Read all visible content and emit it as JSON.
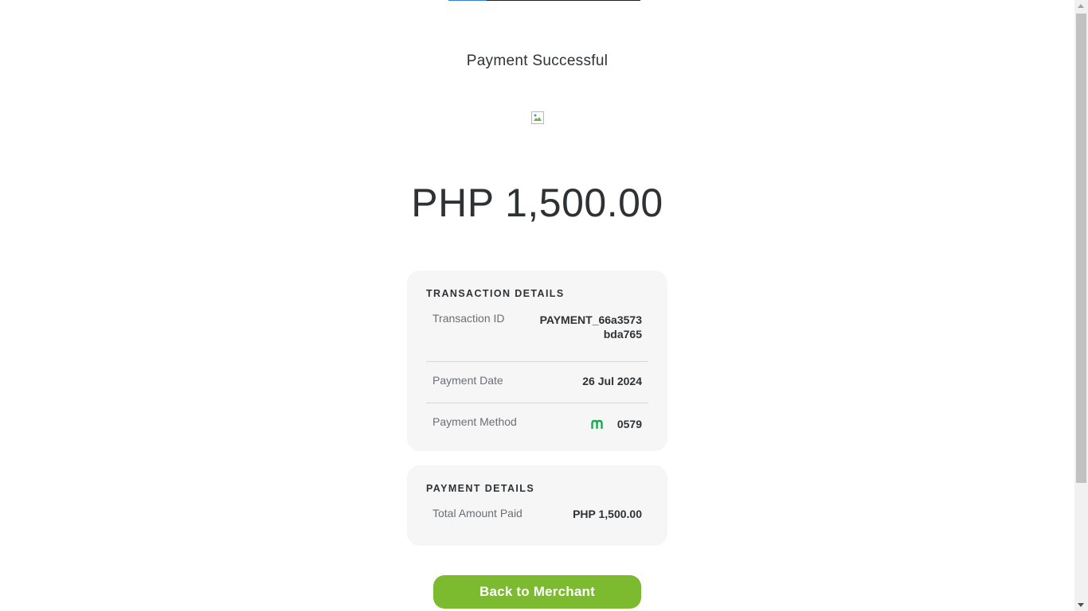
{
  "page": {
    "title": "Payment Successful",
    "amount": "PHP 1,500.00"
  },
  "transaction_details": {
    "heading": "TRANSACTION DETAILS",
    "rows": [
      {
        "label": "Transaction ID",
        "value_line1": "PAYMENT_66a3573",
        "value_line2": "bda765"
      },
      {
        "label": "Payment Date",
        "value": "26 Jul 2024"
      },
      {
        "label": "Payment Method",
        "value": "0579",
        "icon": "maya-m-icon"
      }
    ]
  },
  "payment_details": {
    "heading": "PAYMENT DETAILS",
    "rows": [
      {
        "label": "Total Amount Paid",
        "value": "PHP 1,500.00"
      }
    ]
  },
  "actions": {
    "back_label": "Back to Merchant"
  },
  "colors": {
    "accent_green": "#7cba2f",
    "icon_green": "#1aa74f",
    "progress_blue": "#2f7de1"
  }
}
